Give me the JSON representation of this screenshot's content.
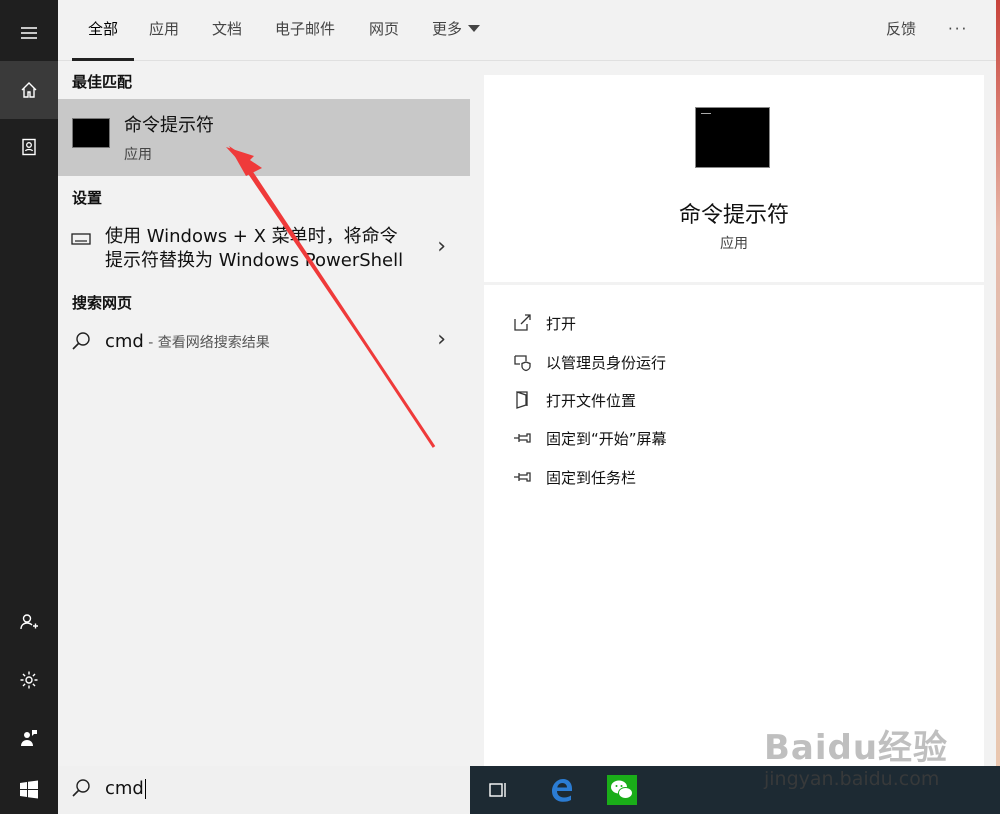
{
  "tabs": [
    {
      "label": "全部",
      "active": true
    },
    {
      "label": "应用"
    },
    {
      "label": "文档"
    },
    {
      "label": "电子邮件"
    },
    {
      "label": "网页"
    },
    {
      "label": "更多"
    }
  ],
  "header": {
    "feedback": "反馈",
    "more": "···"
  },
  "results": {
    "best_match_heading": "最佳匹配",
    "best_match": {
      "name": "命令提示符",
      "type": "应用"
    },
    "settings_heading": "设置",
    "setting_item": {
      "line1": "使用 Windows + X 菜单时，将命令",
      "line2": "提示符替换为 Windows PowerShell"
    },
    "web_heading": "搜索网页",
    "web_item": {
      "query": "cmd",
      "hint": " - 查看网络搜索结果"
    }
  },
  "detail": {
    "title": "命令提示符",
    "subtitle": "应用",
    "actions": [
      {
        "label": "打开",
        "icon": "open-icon"
      },
      {
        "label": "以管理员身份运行",
        "icon": "shield-icon"
      },
      {
        "label": "打开文件位置",
        "icon": "file-location-icon"
      },
      {
        "label": "固定到“开始”屏幕",
        "icon": "pin-icon"
      },
      {
        "label": "固定到任务栏",
        "icon": "pin-icon"
      }
    ]
  },
  "search": {
    "value": "cmd"
  },
  "watermark": {
    "brand": "Baidu经验",
    "url": "jingyan.baidu.com"
  },
  "colors": {
    "rail": "#1f1f1f",
    "highlight": "#c8c8c8",
    "taskbar": "#1d2a33",
    "arrow": "#ef3a3a"
  }
}
